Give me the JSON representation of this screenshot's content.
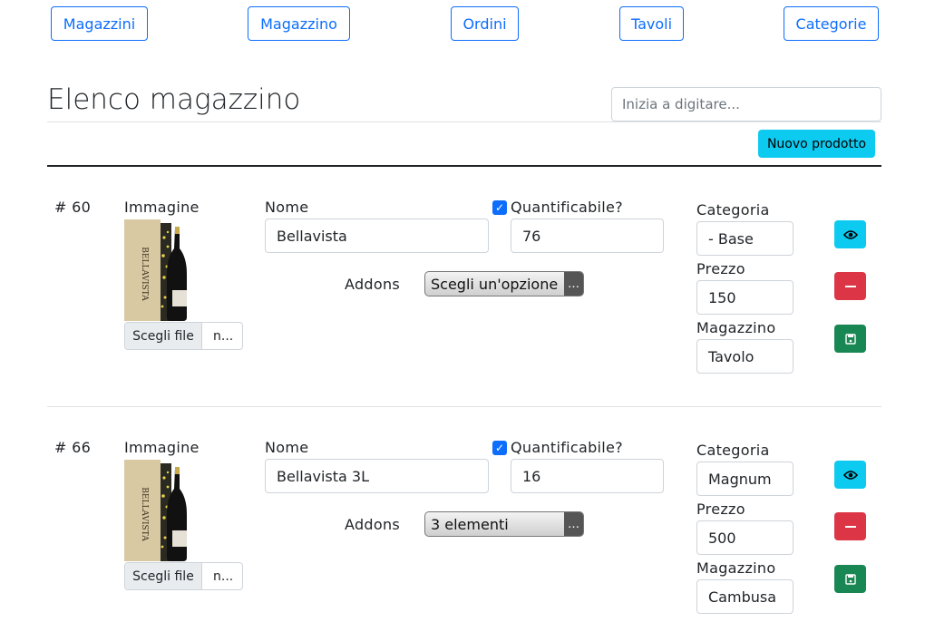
{
  "nav": {
    "items": [
      "Magazzini",
      "Magazzino",
      "Ordini",
      "Tavoli",
      "Categorie"
    ]
  },
  "page": {
    "title": "Elenco magazzino",
    "search_placeholder": "Inizia a digitare...",
    "new_product_label": "Nuovo prodotto"
  },
  "labels": {
    "image": "Immagine",
    "name": "Nome",
    "quantifiable": "Quantificabile?",
    "addons": "Addons",
    "category": "Categoria",
    "price": "Prezzo",
    "warehouse": "Magazzino",
    "choose_file": "Scegli file",
    "file_name": "n..."
  },
  "products": [
    {
      "id_label": "# 60",
      "name": "Bellavista",
      "quantifiable": true,
      "quantity": "76",
      "addons": "Scegli un'opzione",
      "category": "- Base",
      "price": "150",
      "warehouse": "Tavolo"
    },
    {
      "id_label": "# 66",
      "name": "Bellavista 3L",
      "quantifiable": true,
      "quantity": "16",
      "addons": "3 elementi",
      "category": "Magnum",
      "price": "500",
      "warehouse": "Cambusa"
    }
  ],
  "bottle_label": "BELLAVISTA",
  "colors": {
    "primary": "#0d6efd",
    "info": "#0dcaf0",
    "danger": "#dc3545",
    "success": "#198754"
  }
}
